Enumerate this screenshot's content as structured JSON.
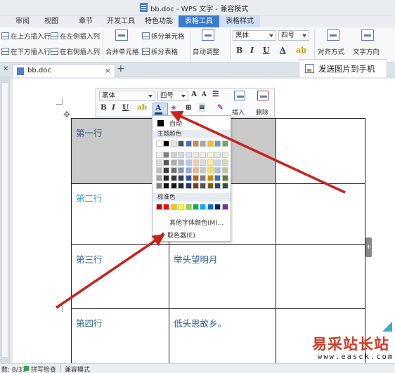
{
  "window": {
    "title": "bb.doc - WPS 文字 - 兼容模式"
  },
  "ribbon_tabs": [
    {
      "label": "审阅"
    },
    {
      "label": "视图"
    },
    {
      "label": "章节"
    },
    {
      "label": "开发工具"
    },
    {
      "label": "特色功能"
    },
    {
      "label": "表格工具"
    },
    {
      "label": "表格样式"
    }
  ],
  "ribbon": {
    "insert_above": "在上方插入行",
    "insert_left": "在左侧插入列",
    "insert_below": "在下方插入行",
    "insert_right": "在右侧插入列",
    "merge_cells": "合并单元格",
    "split_cells": "拆分单元格",
    "split_table": "拆分表格",
    "auto_adjust": "自动调整",
    "font_name": "黑体",
    "font_size": "四号",
    "bold": "B",
    "italic": "I",
    "underline": "U",
    "font_color": "A",
    "align": "对齐方式",
    "text_direction": "文字方向"
  },
  "doc_tabs": [
    {
      "label": "bb.doc"
    }
  ],
  "send_button": {
    "label": "发送图片到手机"
  },
  "mini_toolbar": {
    "font_name": "黑体",
    "font_size": "四号",
    "grow": "A",
    "shrink": "A",
    "bold": "B",
    "italic": "I",
    "underline": "U",
    "font_color": "A",
    "insert": "插入",
    "delete": "删除"
  },
  "color_menu": {
    "auto": "自动",
    "theme_header": "主题颜色",
    "standard_header": "标准色",
    "more_colors": "其他字体颜色(M)...",
    "eyedropper": "取色器(E)",
    "theme_row": [
      "#ffffff",
      "#000000",
      "#e7e6e6",
      "#44546a",
      "#4472c4",
      "#ed7d31",
      "#a5a5a5",
      "#ffc000",
      "#5b9bd5",
      "#70ad47"
    ],
    "theme_shades": [
      [
        "#f2f2f2",
        "#808080",
        "#d0cece",
        "#d6dce5",
        "#d9e2f3",
        "#fbe5d6",
        "#ededed",
        "#fff2cc",
        "#deebf7",
        "#e2f0d9"
      ],
      [
        "#d9d9d9",
        "#595959",
        "#aeabab",
        "#adb9ca",
        "#b4c7e7",
        "#f8cbad",
        "#dbdbdb",
        "#ffe699",
        "#bdd7ee",
        "#c5e0b4"
      ],
      [
        "#bfbfbf",
        "#404040",
        "#757171",
        "#8497b0",
        "#8faadc",
        "#f4b183",
        "#c9c9c9",
        "#ffd966",
        "#9dc3e6",
        "#a9d18e"
      ],
      [
        "#a6a6a6",
        "#262626",
        "#3a3838",
        "#333f50",
        "#2f5597",
        "#c55a11",
        "#7b7b7b",
        "#bf9000",
        "#2e75b6",
        "#548235"
      ],
      [
        "#7f7f7f",
        "#0d0d0d",
        "#171616",
        "#222a35",
        "#203864",
        "#843c0c",
        "#525252",
        "#7f6000",
        "#1f4e79",
        "#385723"
      ]
    ],
    "standard": [
      "#c00000",
      "#ff0000",
      "#ffc000",
      "#ffff00",
      "#92d050",
      "#00b050",
      "#00b0f0",
      "#0070c0",
      "#002060",
      "#7030a0"
    ]
  },
  "table": {
    "rows": [
      [
        "第一行",
        "",
        ""
      ],
      [
        "第二行",
        "",
        ""
      ],
      [
        "第三行",
        "举头望明月",
        ""
      ],
      [
        "第四行",
        "低头思故乡。",
        ""
      ]
    ]
  },
  "status_bar": {
    "page_info": "数: 8/33",
    "spell_check": "拼写检查",
    "compat_mode": "兼容模式"
  },
  "watermark": {
    "text": "易采站长站",
    "url": "www.easck.com"
  },
  "colors": {
    "ribbon_active": "#3d7bd0",
    "arrow": "#c8231b",
    "selection_gray": "#c9c9c9"
  }
}
